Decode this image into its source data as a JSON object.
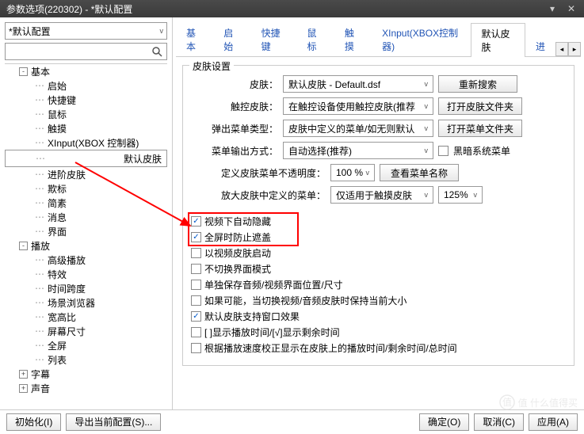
{
  "window": {
    "title": "参数选项(220302) - *默认配置"
  },
  "preset": {
    "current": "*默认配置"
  },
  "search": {
    "placeholder": ""
  },
  "tree": {
    "items": [
      {
        "depth": 1,
        "expand": "-",
        "label": "基本"
      },
      {
        "depth": 2,
        "label": "启始"
      },
      {
        "depth": 2,
        "label": "快捷键"
      },
      {
        "depth": 2,
        "label": "鼠标"
      },
      {
        "depth": 2,
        "label": "触摸"
      },
      {
        "depth": 2,
        "label": "XInput(XBOX 控制器)"
      },
      {
        "depth": 2,
        "label": "默认皮肤",
        "selected": true
      },
      {
        "depth": 2,
        "label": "进阶皮肤"
      },
      {
        "depth": 2,
        "label": "欺标"
      },
      {
        "depth": 2,
        "label": "简素"
      },
      {
        "depth": 2,
        "label": "消息"
      },
      {
        "depth": 2,
        "label": "界面"
      },
      {
        "depth": 1,
        "expand": "-",
        "label": "播放"
      },
      {
        "depth": 2,
        "label": "高级播放"
      },
      {
        "depth": 2,
        "label": "特效"
      },
      {
        "depth": 2,
        "label": "时间跨度"
      },
      {
        "depth": 2,
        "label": "场景浏览器"
      },
      {
        "depth": 2,
        "label": "宽高比"
      },
      {
        "depth": 2,
        "label": "屏幕尺寸"
      },
      {
        "depth": 2,
        "label": "全屏"
      },
      {
        "depth": 2,
        "label": "列表"
      },
      {
        "depth": 1,
        "expand": "+",
        "label": "字幕"
      },
      {
        "depth": 1,
        "expand": "+",
        "label": "声音"
      }
    ]
  },
  "tabs": {
    "items": [
      "基本",
      "启始",
      "快捷键",
      "鼠标",
      "触摸",
      "XInput(XBOX控制器)",
      "默认皮肤",
      "进"
    ],
    "active": 6
  },
  "group": {
    "title": "皮肤设置",
    "rows": {
      "skin_lbl": "皮肤：",
      "skin_val": "默认皮肤 - Default.dsf",
      "skin_btn": "重新搜索",
      "touch_lbl": "触控皮肤：",
      "touch_val": "在触控设备使用触控皮肤(推荐",
      "touch_btn": "打开皮肤文件夹",
      "menu_lbl": "弹出菜单类型：",
      "menu_val": "皮肤中定义的菜单/如无则默认",
      "menu_btn": "打开菜单文件夹",
      "out_lbl": "菜单输出方式：",
      "out_val": "自动选择(推荐)",
      "out_chk": "黑暗系统菜单",
      "opacity_lbl": "定义皮肤菜单不透明度：",
      "opacity_val": "100 %",
      "opacity_btn": "查看菜单名称",
      "zoom_lbl": "放大皮肤中定义的菜单：",
      "zoom_val": "仅适用于触摸皮肤",
      "zoom_pct": "125%"
    },
    "checks": [
      {
        "checked": true,
        "label": "视频下自动隐藏",
        "hl": true
      },
      {
        "checked": true,
        "label": "全屏时防止遮盖",
        "hl": true
      },
      {
        "checked": false,
        "label": "以视频皮肤启动"
      },
      {
        "checked": false,
        "label": "不切换界面模式"
      },
      {
        "checked": false,
        "label": "单独保存音频/视频界面位置/尺寸"
      },
      {
        "checked": false,
        "label": "如果可能，当切换视频/音频皮肤时保持当前大小"
      },
      {
        "checked": true,
        "label": "默认皮肤支持窗口效果"
      },
      {
        "checked": false,
        "label": "[ ]显示播放时间/[√]显示剩余时间"
      },
      {
        "checked": false,
        "label": "根据播放速度校正显示在皮肤上的播放时间/剩余时间/总时间"
      }
    ]
  },
  "buttons": {
    "init": "初始化(I)",
    "export": "导出当前配置(S)...",
    "ok": "确定(O)",
    "cancel": "取消(C)",
    "apply": "应用(A)"
  },
  "watermark": "值   什么值得买"
}
